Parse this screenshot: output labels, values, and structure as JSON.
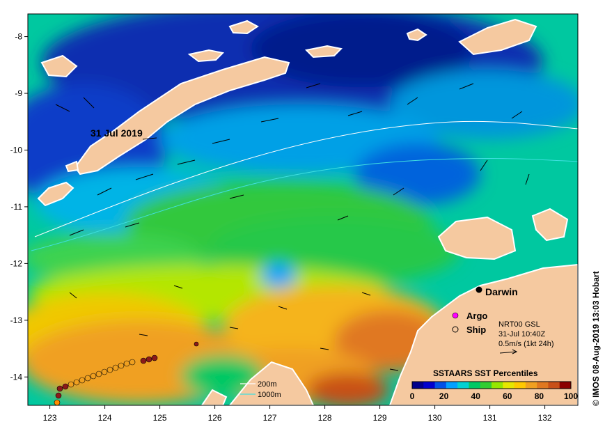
{
  "map": {
    "date_label": "31 Jul 2019",
    "credit": "© IMOS 08-Aug-2019 13:03 Hobart",
    "lon_ticks": [
      "123",
      "124",
      "125",
      "126",
      "127",
      "128",
      "129",
      "130",
      "131",
      "132"
    ],
    "lat_ticks": [
      "-8",
      "-9",
      "-10",
      "-11",
      "-12",
      "-13",
      "-14"
    ],
    "lon_range": [
      122.6,
      132.6
    ],
    "lat_range": [
      -7.6,
      -14.5
    ],
    "places": [
      {
        "name": "Darwin",
        "lon": 130.84,
        "lat": -12.46
      }
    ]
  },
  "legend_markers": {
    "argo_label": "Argo",
    "ship_label": "Ship"
  },
  "current_info": {
    "source": "NRT00 GSL",
    "time": "31-Jul 10:40Z",
    "scale": "0.5m/s (1kt 24h)"
  },
  "bathymetry_legend": {
    "contour_200": "200m",
    "contour_1000": "1000m"
  },
  "colorbar": {
    "title": "SSTAARS SST Percentiles",
    "ticks": [
      "0",
      "20",
      "40",
      "60",
      "80",
      "100"
    ],
    "colors": [
      "#00008b",
      "#0000cd",
      "#0050e6",
      "#00a0ff",
      "#00d2d2",
      "#00c864",
      "#32cd32",
      "#96e600",
      "#e6e600",
      "#ffc800",
      "#f0a020",
      "#e07820",
      "#c85018",
      "#8b0000"
    ]
  },
  "colors": {
    "land": "#f5c9a0",
    "coast_outline": "#ffffff",
    "argo_marker": "#ff00ff",
    "ship_marker": "#ff8c00"
  }
}
